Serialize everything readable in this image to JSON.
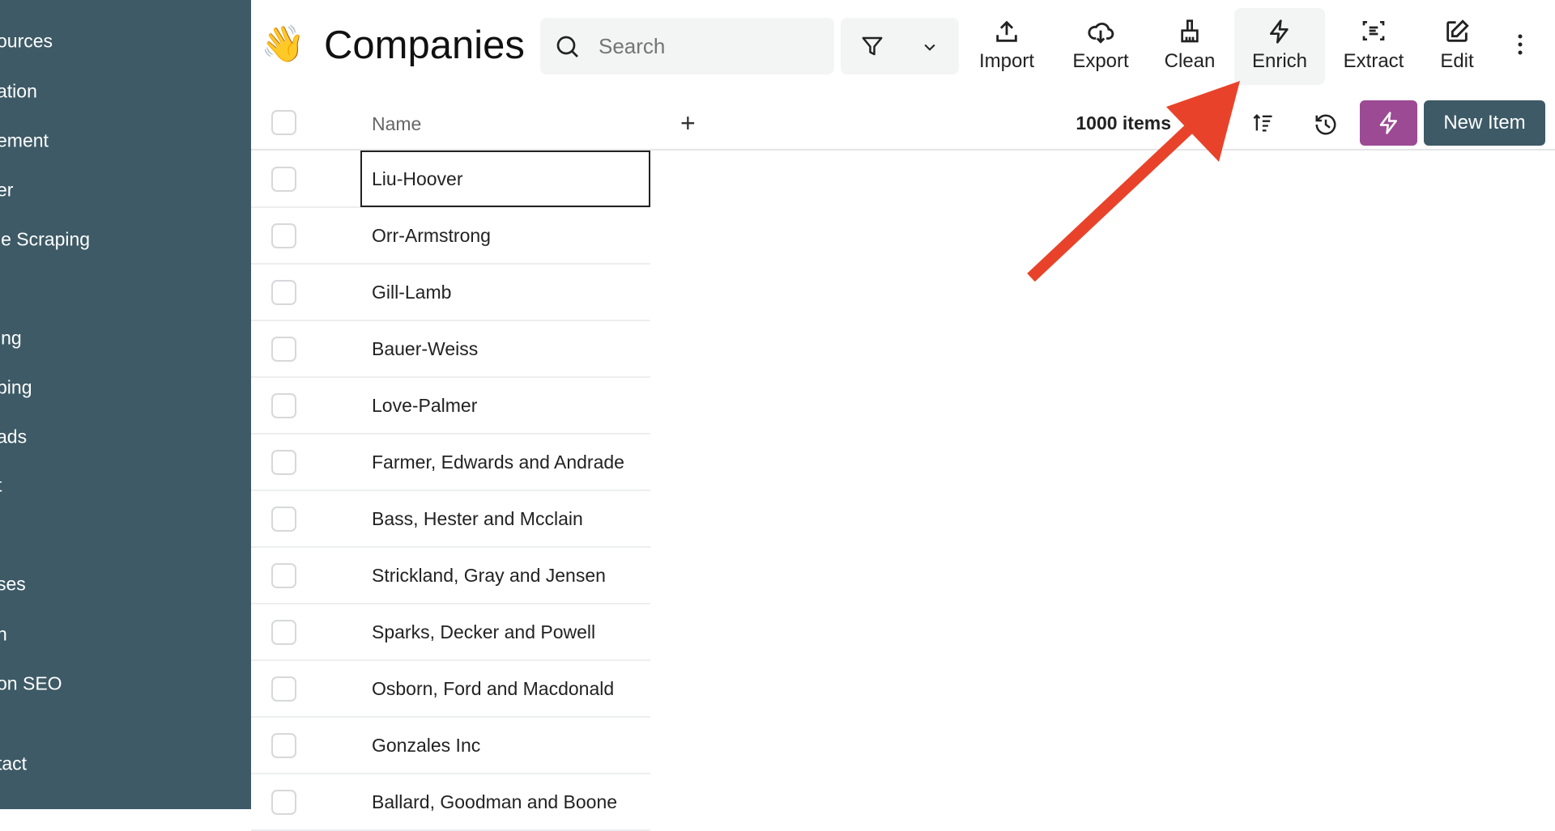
{
  "sidebar": {
    "items": [
      "ources",
      "ation",
      "ement",
      "er",
      "le Scraping",
      "ing",
      "ping",
      "ads",
      "t",
      "ses",
      "n",
      "on SEO",
      "tact"
    ]
  },
  "header": {
    "emoji": "👋",
    "title": "Companies",
    "search_placeholder": "Search"
  },
  "toolbar": {
    "items": [
      {
        "label": "Import",
        "icon": "upload-icon"
      },
      {
        "label": "Export",
        "icon": "cloud-download-icon"
      },
      {
        "label": "Clean",
        "icon": "broom-icon"
      },
      {
        "label": "Enrich",
        "icon": "lightning-icon",
        "active": true
      },
      {
        "label": "Extract",
        "icon": "scan-text-icon"
      },
      {
        "label": "Edit",
        "icon": "edit-icon"
      }
    ]
  },
  "table": {
    "column": "Name",
    "count": "1000 items",
    "new_item": "New Item",
    "rows": [
      "Liu-Hoover",
      "Orr-Armstrong",
      "Gill-Lamb",
      "Bauer-Weiss",
      "Love-Palmer",
      "Farmer, Edwards and Andrade",
      "Bass, Hester and Mcclain",
      "Strickland, Gray and Jensen",
      "Sparks, Decker and Powell",
      "Osborn, Ford and Macdonald",
      "Gonzales Inc",
      "Ballard, Goodman and Boone"
    ]
  },
  "colors": {
    "sidebar": "#3d5a66",
    "accent_purple": "#9c4a94",
    "annotation_arrow": "#e8432a"
  }
}
